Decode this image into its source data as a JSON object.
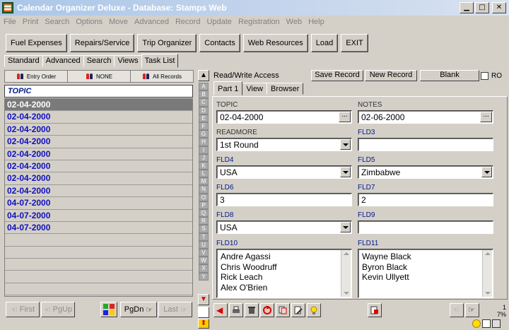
{
  "window": {
    "title": "Calendar Organizer Deluxe - Database: Stamps Web",
    "controls": [
      "minimize",
      "maximize",
      "close"
    ]
  },
  "menu": [
    "File",
    "Print",
    "Search",
    "Options",
    "Move",
    "Advanced",
    "Record",
    "Update",
    "Registration",
    "Web",
    "Help"
  ],
  "toolbar": [
    "Fuel Expenses",
    "Repairs/Service",
    "Trip Organizer",
    "Contacts",
    "Web Resources",
    "Load",
    "EXIT"
  ],
  "left_tabs": [
    "Standard",
    "Advanced",
    "Search",
    "Views",
    "Task List"
  ],
  "left_active_tab": "Task List",
  "sort_bar": [
    "Entry Order",
    "NONE",
    "All Records"
  ],
  "list": {
    "header": "TOPIC",
    "rows": [
      "02-04-2000",
      "02-04-2000",
      "02-04-2000",
      "02-04-2000",
      "02-04-2000",
      "02-04-2000",
      "02-04-2000",
      "02-04-2000",
      "04-07-2000",
      "04-07-2000",
      "04-07-2000"
    ],
    "selected_index": 0
  },
  "alphabet": [
    "A",
    "B",
    "C",
    "D",
    "E",
    "F",
    "G",
    "H",
    "I",
    "J",
    "K",
    "L",
    "M",
    "N",
    "O",
    "P",
    "Q",
    "R",
    "S",
    "T",
    "U",
    "V",
    "W",
    "X",
    "Y"
  ],
  "header_bar": {
    "access": "Read/Write Access",
    "save": "Save Record",
    "new": "New Record",
    "blank": "Blank",
    "ro": "RO"
  },
  "right_tabs": [
    "Part 1",
    "View",
    "Browser"
  ],
  "right_active_tab": "Part 1",
  "fields": {
    "topic_label": "TOPIC",
    "topic": "02-04-2000",
    "notes_label": "NOTES",
    "notes": "02-06-2000",
    "readmore_label": "READMORE",
    "readmore": "1st Round",
    "fld3_label": "FLD3",
    "fld3": "",
    "fld4_label": "FLD4",
    "fld4": "USA",
    "fld5_label": "FLD5",
    "fld5": "Zimbabwe",
    "fld6_label": "FLD6",
    "fld6": "3",
    "fld7_label": "FLD7",
    "fld7": "2",
    "fld8_label": "FLD8",
    "fld8": "USA",
    "fld9_label": "FLD9",
    "fld9": "",
    "fld10_label": "FLD10",
    "fld10": [
      "Andre Agassi",
      "Chris Woodruff",
      "Rick Leach",
      "Alex O'Brien"
    ],
    "fld11_label": "FLD11",
    "fld11": [
      "Wayne Black",
      "Byron Black",
      "Kevin Ullyett"
    ]
  },
  "nav": {
    "first": "First",
    "pgup": "PgUp",
    "pgdn": "PgDn",
    "last": "Last"
  },
  "status": {
    "count": "1",
    "percent": "7%"
  },
  "colors": {
    "title_gradient_start": "#a9c6e8",
    "list_text": "#1010c0",
    "selected_row": "#7a7a7a",
    "header_text": "#001a8c"
  }
}
